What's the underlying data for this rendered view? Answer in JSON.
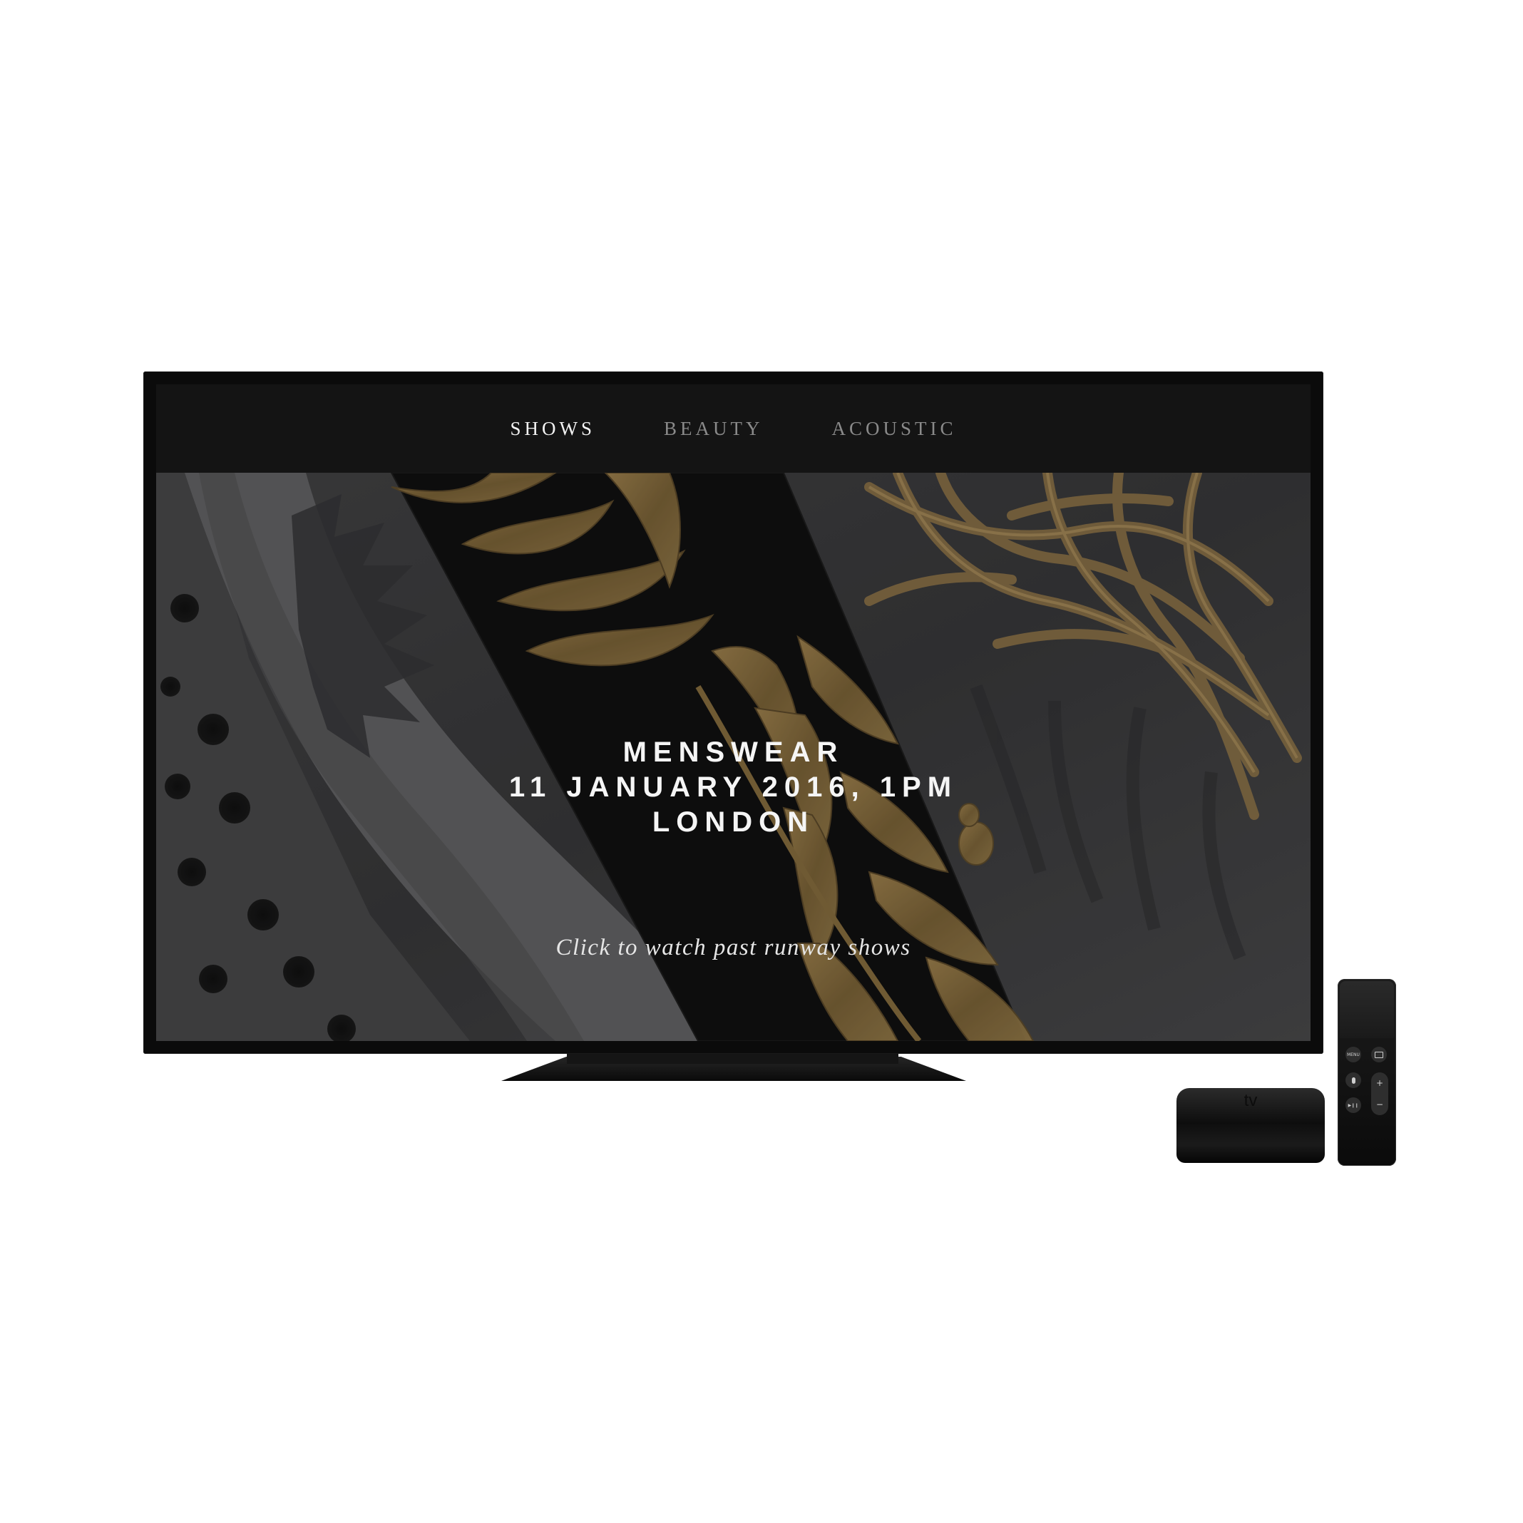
{
  "nav": {
    "items": [
      {
        "label": "SHOWS",
        "active": true
      },
      {
        "label": "BEAUTY",
        "active": false
      },
      {
        "label": "ACOUSTIC",
        "active": false
      }
    ]
  },
  "hero": {
    "line1": "MENSWEAR",
    "line2": "11 JANUARY 2016, 1PM",
    "line3": "LONDON",
    "cta": "Click to watch past runway shows"
  },
  "device": {
    "box_logo": " tv",
    "remote_menu_label": "MENU",
    "remote_plus": "+",
    "remote_minus": "−",
    "remote_play": "▶❙❙"
  },
  "colors": {
    "nav_active": "#f2f2f2",
    "nav_inactive": "#8a8a8a",
    "gold": "#a98a4e",
    "topbar": "#141414"
  }
}
